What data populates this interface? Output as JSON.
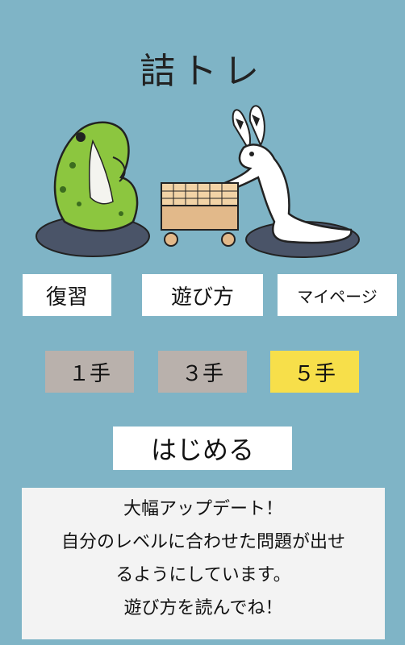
{
  "title": "詰トレ",
  "menu": {
    "review": "復習",
    "how_to_play": "遊び方",
    "my_page": "マイページ"
  },
  "levels": [
    {
      "label": "１手",
      "selected": false
    },
    {
      "label": "３手",
      "selected": false
    },
    {
      "label": "５手",
      "selected": true
    }
  ],
  "colors": {
    "background": "#7fb4c6",
    "selected_level": "#f7df4a",
    "unselected_level": "#b9b1ac"
  },
  "start_label": "はじめる",
  "notice": {
    "lines": [
      "大幅アップデート！",
      "自分のレベルに合わせた問題が出せ",
      "るようにしています。",
      "遊び方を読んでね！"
    ]
  }
}
